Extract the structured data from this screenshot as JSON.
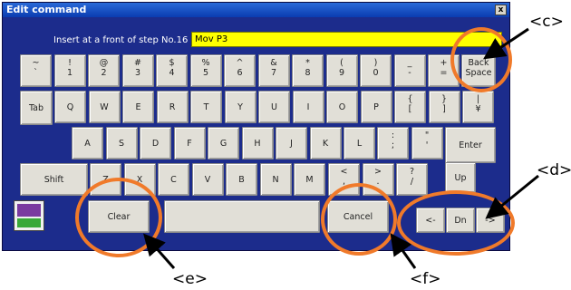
{
  "window": {
    "title": "Edit command",
    "close_label": "x"
  },
  "editor": {
    "insert_label": "Insert at a front of step No.16",
    "command_value": "Mov P3"
  },
  "keys": {
    "row1": [
      {
        "top": "~",
        "bot": "`"
      },
      {
        "top": "!",
        "bot": "1"
      },
      {
        "top": "@",
        "bot": "2"
      },
      {
        "top": "#",
        "bot": "3"
      },
      {
        "top": "$",
        "bot": "4"
      },
      {
        "top": "%",
        "bot": "5"
      },
      {
        "top": "^",
        "bot": "6"
      },
      {
        "top": "&",
        "bot": "7"
      },
      {
        "top": "*",
        "bot": "8"
      },
      {
        "top": "(",
        "bot": "9"
      },
      {
        "top": ")",
        "bot": "0"
      },
      {
        "top": "_",
        "bot": "-"
      },
      {
        "top": "+",
        "bot": "="
      }
    ],
    "backspace": {
      "top": "Back",
      "bot": "Space"
    },
    "tab": "Tab",
    "row2": [
      "Q",
      "W",
      "E",
      "R",
      "T",
      "Y",
      "U",
      "I",
      "O",
      "P"
    ],
    "row2_sym": [
      {
        "top": "{",
        "bot": "["
      },
      {
        "top": "}",
        "bot": "]"
      },
      {
        "top": "|",
        "bot": "¥"
      }
    ],
    "row3": [
      "A",
      "S",
      "D",
      "F",
      "G",
      "H",
      "J",
      "K",
      "L"
    ],
    "row3_sym": [
      {
        "top": ":",
        "bot": ";"
      },
      {
        "top": "\"",
        "bot": "'"
      }
    ],
    "enter": "Enter",
    "shift": "Shift",
    "row4": [
      "Z",
      "X",
      "C",
      "V",
      "B",
      "N",
      "M"
    ],
    "row4_sym": [
      {
        "top": "<",
        "bot": ","
      },
      {
        "top": ">",
        "bot": "."
      },
      {
        "top": "?",
        "bot": "/"
      }
    ],
    "clear": "Clear",
    "space": "",
    "cancel": "Cancel",
    "arrows": {
      "up": "Up",
      "left": "<-",
      "down": "Dn",
      "right": "->"
    }
  },
  "callouts": {
    "c": "<c>",
    "d": "<d>",
    "e": "<e>",
    "f": "<f>"
  },
  "colors": {
    "dialog_bg": "#1c2c8c",
    "field_bg": "#ffff00",
    "ring": "#f07a2a",
    "key_bg": "#e1dfd7"
  }
}
